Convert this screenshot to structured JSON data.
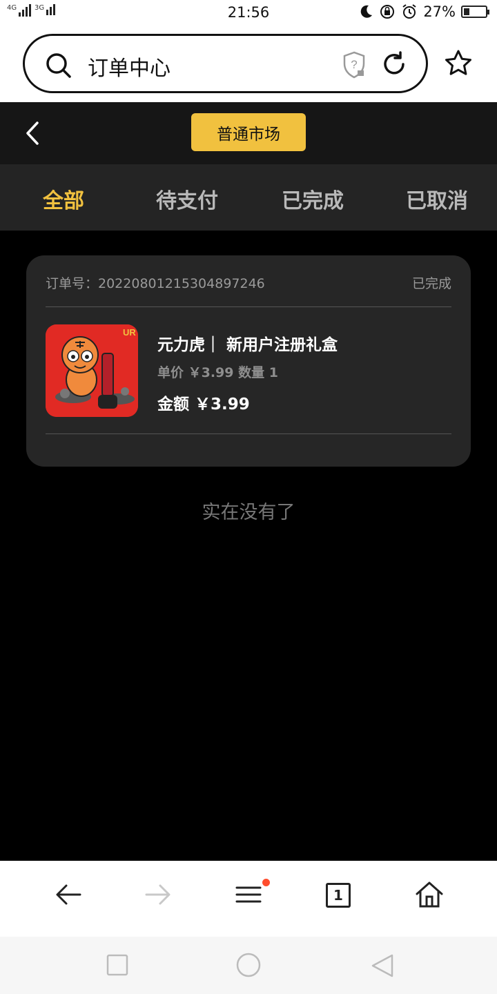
{
  "status_bar": {
    "signal_1": "4G",
    "signal_2": "3G",
    "time": "21:56",
    "battery": "27%",
    "battery_level": 0.27,
    "icons": [
      "moon-icon",
      "rotation-lock-icon",
      "alarm-icon",
      "battery-icon"
    ]
  },
  "browser": {
    "search_text": "订单中心",
    "icons": [
      "search-icon",
      "security-shield-icon",
      "reload-icon",
      "star-icon"
    ]
  },
  "header": {
    "back_icon": "chevron-left-icon",
    "market_button": "普通市场",
    "accent_color": "#f1c13f"
  },
  "tabs": [
    {
      "label": "全部",
      "active": true
    },
    {
      "label": "待支付",
      "active": false
    },
    {
      "label": "已完成",
      "active": false
    },
    {
      "label": "已取消",
      "active": false
    }
  ],
  "order": {
    "order_no": "订单号：20220801215304897246",
    "status": "已完成",
    "product_name": "元力虎｜ 新用户注册礼盒",
    "unit_line": "单价 ￥3.99 数量 1",
    "amount_line": "金额 ￥3.99",
    "thumbnail_badge": "UR"
  },
  "empty_hint": "实在没有了",
  "bottom_toolbar": {
    "tab_count": "1",
    "icons": [
      "arrow-left-icon",
      "arrow-right-icon",
      "menu-icon",
      "tabs-icon",
      "home-icon"
    ]
  },
  "nav_bar": {
    "icons": [
      "recents-square-icon",
      "home-circle-icon",
      "back-triangle-icon"
    ]
  }
}
